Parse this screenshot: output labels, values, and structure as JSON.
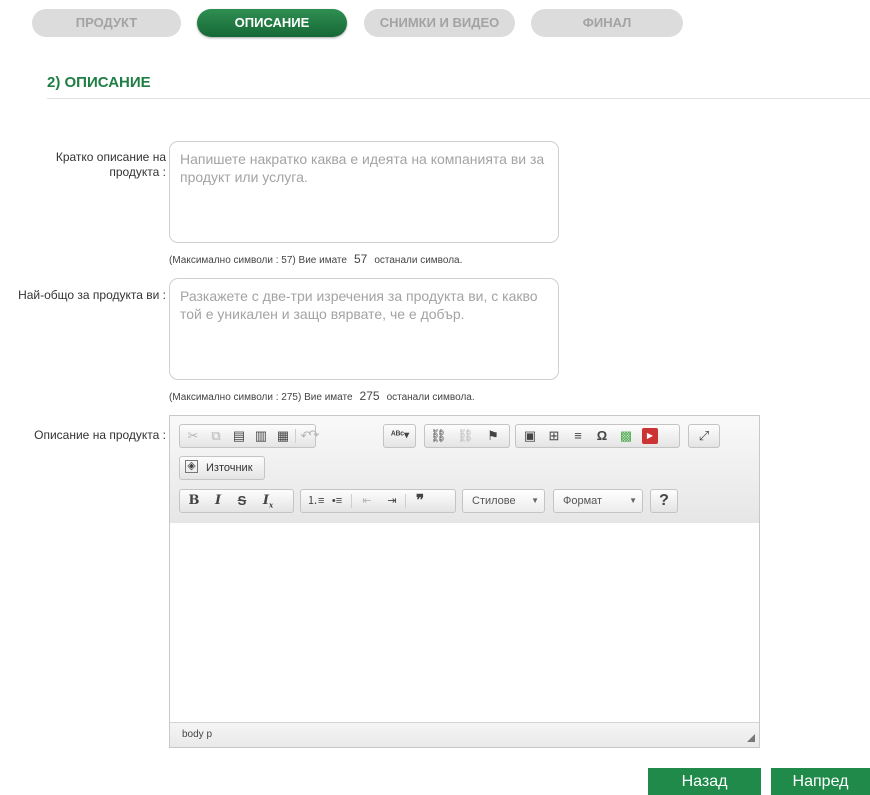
{
  "steps": [
    "ПРОДУКТ",
    "ОПИСАНИЕ",
    "СНИМКИ И ВИДЕО",
    "ФИНАЛ"
  ],
  "active_step": "ОПИСАНИЕ",
  "section_title": "2) ОПИСАНИЕ",
  "fields": {
    "short": {
      "label": "Кратко описание на продукта :",
      "placeholder": "Напишете накратко каква е идеята на компанията ви за продукт или услуга.",
      "counter_prefix": "(Максимално символи : 57) Вие имате",
      "remaining": "57",
      "counter_suffix": "останали символа."
    },
    "general": {
      "label": "Най-общо за продукта ви :",
      "placeholder": "Разкажете с две-три изречения за продукта ви, с какво той е уникален и защо вярвате, че е добър.",
      "counter_prefix": "(Максимално символи : 275) Вие имате",
      "remaining": "275",
      "counter_suffix": "останали символа."
    },
    "description": {
      "label": "Описание на продукта :"
    }
  },
  "editor": {
    "source_label": "Източник",
    "styles_label": "Стилове",
    "format_label": "Формат",
    "status_path": "body  p"
  },
  "icons": {
    "cut": "cut-icon",
    "copy": "copy-icon",
    "paste": "paste-icon",
    "paste_text": "paste-text-icon",
    "paste_word": "paste-word-icon",
    "undo": "undo-icon",
    "redo": "redo-icon",
    "spellcheck": "spellcheck-icon",
    "link": "link-icon",
    "unlink": "unlink-icon",
    "anchor": "anchor-icon",
    "image": "image-icon",
    "table": "table-icon",
    "hr": "horizontal-rule-icon",
    "special_char": "special-char-icon",
    "flash": "flash-icon",
    "youtube": "youtube-icon",
    "maximize": "maximize-icon",
    "help": "help-icon"
  },
  "buttons": {
    "back": "Назад",
    "next": "Напред"
  },
  "colors": {
    "accent": "#1e7e44",
    "button": "#1f8a4a",
    "inactive_step": "#dcdcdc"
  }
}
